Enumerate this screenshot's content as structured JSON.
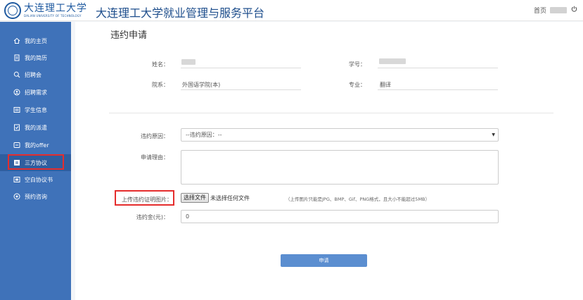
{
  "header": {
    "logo_text": "大连理工大学",
    "logo_en": "DALIAN UNIVERSITY OF TECHNOLOGY",
    "platform_title": "大连理工大学就业管理与服务平台",
    "home_link": "首页",
    "power_icon": "power-icon"
  },
  "sidebar": {
    "items": [
      {
        "label": "我的主页",
        "icon": "home-icon"
      },
      {
        "label": "我的简历",
        "icon": "resume-icon"
      },
      {
        "label": "招聘会",
        "icon": "search-icon"
      },
      {
        "label": "招聘需求",
        "icon": "demand-icon"
      },
      {
        "label": "学生信息",
        "icon": "info-icon"
      },
      {
        "label": "我的派遣",
        "icon": "dispatch-icon"
      },
      {
        "label": "我的offer",
        "icon": "offer-icon"
      },
      {
        "label": "三方协议",
        "icon": "agreement-icon"
      },
      {
        "label": "空白协议书",
        "icon": "blank-agreement-icon"
      },
      {
        "label": "预约咨询",
        "icon": "consult-icon"
      }
    ],
    "active_index": 7
  },
  "main": {
    "page_title": "违约申请",
    "fields": {
      "name_label": "姓名：",
      "student_id_label": "学号：",
      "dept_label": "院系：",
      "dept_value": "外国语学院(本)",
      "major_label": "专业：",
      "major_value": "翻译"
    },
    "form": {
      "reason_label": "违约原因：",
      "reason_selected": "--违约原因：--",
      "apply_reason_label": "申请理由：",
      "upload_label": "上传违约证明图片：",
      "file_button": "选择文件",
      "file_status": "未选择任何文件",
      "upload_hint": "（上传图片只能是JPG、BMP、Gif、PNG格式，且大小不能超过5MB）",
      "deposit_label": "违约金(元)：",
      "deposit_value": "0",
      "submit_label": "申请"
    }
  },
  "colors": {
    "sidebar": "#3f72b9",
    "sidebar_active": "#2f5e9f",
    "highlight": "#e52d2d",
    "button": "#5b8ed0",
    "brand": "#1e4e8c"
  }
}
